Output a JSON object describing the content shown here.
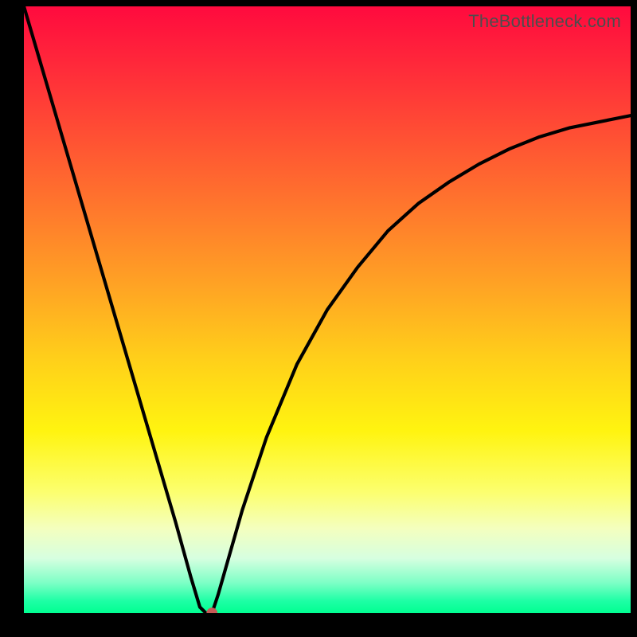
{
  "watermark": "TheBottleneck.com",
  "chart_data": {
    "type": "line",
    "title": "",
    "xlabel": "",
    "ylabel": "",
    "xlim": [
      0,
      100
    ],
    "ylim": [
      0,
      100
    ],
    "series": [
      {
        "name": "curve",
        "x": [
          0,
          5,
          10,
          15,
          20,
          25,
          27.5,
          29,
          30,
          31,
          32,
          34,
          36,
          40,
          45,
          50,
          55,
          60,
          65,
          70,
          75,
          80,
          85,
          90,
          95,
          100
        ],
        "y": [
          100,
          83,
          66,
          49,
          32,
          15,
          6,
          1,
          0,
          0,
          3,
          10,
          17,
          29,
          41,
          50,
          57,
          63,
          67.5,
          71,
          74,
          76.5,
          78.5,
          80,
          81,
          82
        ]
      }
    ],
    "marker": {
      "x": 31,
      "y": 0
    }
  },
  "colors": {
    "curve": "#000000",
    "marker": "#c65a56"
  }
}
